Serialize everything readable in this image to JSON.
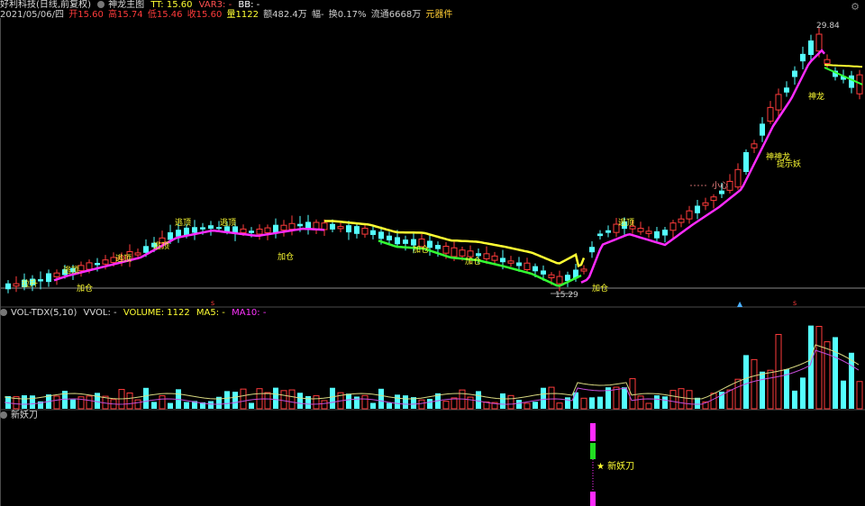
{
  "main_panel": {
    "header": {
      "stock_name": "好利科技(日线,前复权)",
      "indicator_name": "神龙主图",
      "tt": "TT: 15.60",
      "var3": "VAR3: -",
      "bb": "BB: -",
      "date": "2021/05/06/四",
      "open": "开15.60",
      "high": "高15.74",
      "low": "低15.46",
      "close": "收15.60",
      "volume": "量1122",
      "amount": "额482.4万",
      "amplitude": "幅-",
      "turnover": "换0.17%",
      "float_shares": "流通6668万",
      "component": "元器件"
    },
    "annotations": {
      "buy_label": "加仓",
      "top_label": "逃顶",
      "pull_label": "拉升",
      "low_price": "15.29",
      "high_price": "29.84",
      "shenlong_label": "神龙",
      "shenlong2": "神神龙",
      "tiyao": "提示妖",
      "xiaoxin": "小心"
    }
  },
  "volume_panel": {
    "header": {
      "name": "VOL-TDX(5,10)",
      "vvol": "VVOL: -",
      "volume": "VOLUME: 1122",
      "ma5": "MA5: -",
      "ma10": "MA10: -"
    }
  },
  "signal_panel": {
    "header": {
      "name": "新妖刀"
    },
    "signal_label": "★ 新妖刀"
  },
  "colors": {
    "up": "#ff3b3b",
    "down": "#54ffff",
    "ma_magenta": "#ff2bff",
    "ma_yellow": "#ffff33",
    "ma_green": "#33ff33",
    "vol_ma5": "#d7d780",
    "vol_ma10": "#c34dd8"
  },
  "icons": {
    "settings": "gear-icon"
  }
}
